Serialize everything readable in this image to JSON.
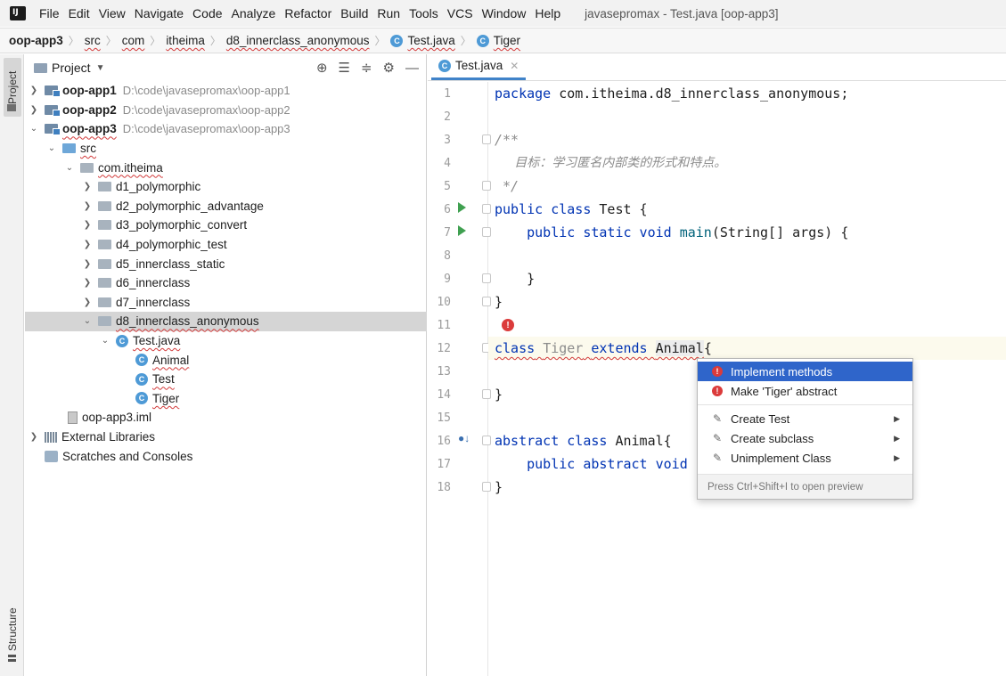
{
  "menubar": {
    "items": [
      "File",
      "Edit",
      "View",
      "Navigate",
      "Code",
      "Analyze",
      "Refactor",
      "Build",
      "Run",
      "Tools",
      "VCS",
      "Window",
      "Help"
    ],
    "window_title": "javasepromax - Test.java [oop-app3]"
  },
  "breadcrumb": [
    "oop-app3",
    "src",
    "com",
    "itheima",
    "d8_innerclass_anonymous",
    "Test.java",
    "Tiger"
  ],
  "toolstrip": {
    "project_tab": "Project",
    "structure_tab": "Structure"
  },
  "project_panel": {
    "title": "Project",
    "tree": [
      {
        "label": "oop-app1",
        "path": "D:\\code\\javasepromax\\oop-app1"
      },
      {
        "label": "oop-app2",
        "path": "D:\\code\\javasepromax\\oop-app2"
      },
      {
        "label": "oop-app3",
        "path": "D:\\code\\javasepromax\\oop-app3"
      },
      {
        "label": "src"
      },
      {
        "label": "com.itheima"
      },
      {
        "label": "d1_polymorphic"
      },
      {
        "label": "d2_polymorphic_advantage"
      },
      {
        "label": "d3_polymorphic_convert"
      },
      {
        "label": "d4_polymorphic_test"
      },
      {
        "label": "d5_innerclass_static"
      },
      {
        "label": "d6_innerclass"
      },
      {
        "label": "d7_innerclass"
      },
      {
        "label": "d8_innerclass_anonymous"
      },
      {
        "label": "Test.java"
      },
      {
        "label": "Animal"
      },
      {
        "label": "Test"
      },
      {
        "label": "Tiger"
      },
      {
        "label": "oop-app3.iml"
      },
      {
        "label": "External Libraries"
      },
      {
        "label": "Scratches and Consoles"
      }
    ]
  },
  "editor": {
    "tab_label": "Test.java",
    "line_numbers": [
      "1",
      "2",
      "3",
      "4",
      "5",
      "6",
      "7",
      "8",
      "9",
      "10",
      "11",
      "12",
      "13",
      "14",
      "15",
      "16",
      "17",
      "18"
    ],
    "code": {
      "l1_kw": "package",
      "l1_rest": " com.itheima.d8_innerclass_anonymous;",
      "l3": "/**",
      "l4": "     目标：学习匿名内部类的形式和特点。",
      "l5": " */",
      "l6_kw": "public class",
      "l6_rest": " Test {",
      "l7_kw": "    public static void",
      "l7_fn": " main",
      "l7_rest": "(String[] args) {",
      "l9": "    }",
      "l10": "}",
      "l12_kw1": "class",
      "l12_name": "Tiger",
      "l12_kw2": "extends",
      "l12_super": "Animal",
      "l12_rest": "{",
      "l14": "}",
      "l16_kw": "abstract class",
      "l16_rest": " Animal{",
      "l17_kw": "    public abstract void",
      "l18": "}"
    }
  },
  "intention_popup": {
    "items": [
      {
        "label": "Implement methods",
        "icon": "error-bulb-icon"
      },
      {
        "label": "Make 'Tiger' abstract",
        "icon": "error-bulb-icon"
      },
      {
        "label": "Create Test",
        "icon": "pen-icon"
      },
      {
        "label": "Create subclass",
        "icon": "pen-icon"
      },
      {
        "label": "Unimplement Class",
        "icon": "pen-icon"
      }
    ],
    "footer": "Press Ctrl+Shift+I to open preview"
  },
  "colors": {
    "selection_accent": "#2f65ca",
    "keyword": "#0033b3",
    "error": "#db3b3b",
    "run": "#3fa050"
  }
}
